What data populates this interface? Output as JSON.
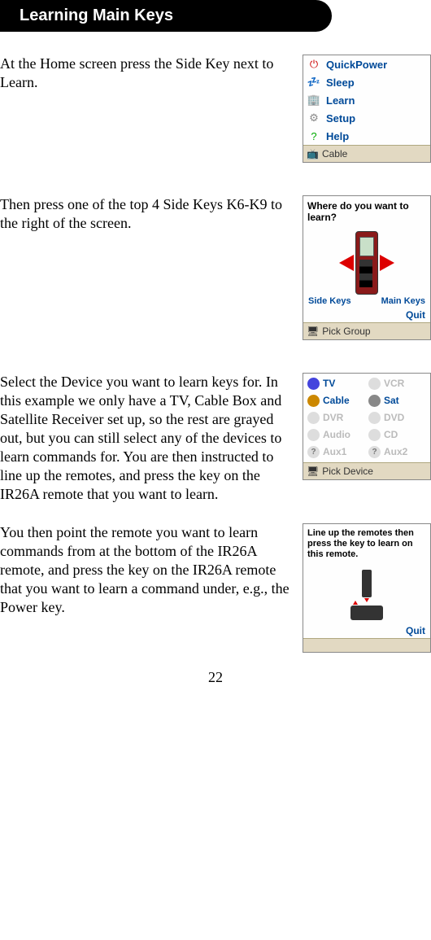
{
  "header": "Learning Main Keys",
  "steps": [
    {
      "text": "At the Home screen press the Side Key next to Learn."
    },
    {
      "text": "Then press one of the top 4 Side Keys K6-K9 to the right of the screen."
    },
    {
      "text": "Select the Device you want to learn keys for. In this example we only have a TV, Cable Box and Satellite Receiver set up, so the rest are grayed out, but you can still select any of the devices to learn commands for. You are then instructed to line up the remotes, and press the key on the IR26A remote that you want to learn."
    },
    {
      "text": "You then point the remote you want to learn commands from at the bottom of the IR26A remote, and press the key on the IR26A remote that you want to learn a command under, e.g., the Power key."
    }
  ],
  "screen1": {
    "items": [
      {
        "icon": "⏻",
        "label": "QuickPower",
        "color": "#c00"
      },
      {
        "icon": "💤",
        "label": "Sleep",
        "color": "#2a6"
      },
      {
        "icon": "🏢",
        "label": "Learn",
        "color": "#a96"
      },
      {
        "icon": "⚙",
        "label": "Setup",
        "color": "#888"
      },
      {
        "icon": "?",
        "label": "Help",
        "color": "#0a0"
      }
    ],
    "status_icon": "📺",
    "status": "Cable"
  },
  "screen2": {
    "prompt": "Where do you want to learn?",
    "side_label": "Side Keys",
    "main_label": "Main Keys",
    "quit": "Quit",
    "status": "Pick Group"
  },
  "screen3": {
    "devices": [
      {
        "label": "TV",
        "active": true,
        "icon_bg": "#44d"
      },
      {
        "label": "VCR",
        "active": false,
        "icon_bg": "#ddd"
      },
      {
        "label": "Cable",
        "active": true,
        "icon_bg": "#c80"
      },
      {
        "label": "Sat",
        "active": true,
        "icon_bg": "#888"
      },
      {
        "label": "DVR",
        "active": false,
        "icon_bg": "#ddd"
      },
      {
        "label": "DVD",
        "active": false,
        "icon_bg": "#ddd"
      },
      {
        "label": "Audio",
        "active": false,
        "icon_bg": "#ddd"
      },
      {
        "label": "CD",
        "active": false,
        "icon_bg": "#ddd"
      },
      {
        "label": "Aux1",
        "active": false,
        "icon_bg": "#ddd",
        "qmark": true
      },
      {
        "label": "Aux2",
        "active": false,
        "icon_bg": "#ddd",
        "qmark": true
      }
    ],
    "status": "Pick Device"
  },
  "screen4": {
    "prompt": "Line up the remotes then press the key to learn on this remote.",
    "quit": "Quit"
  },
  "page_number": "22"
}
